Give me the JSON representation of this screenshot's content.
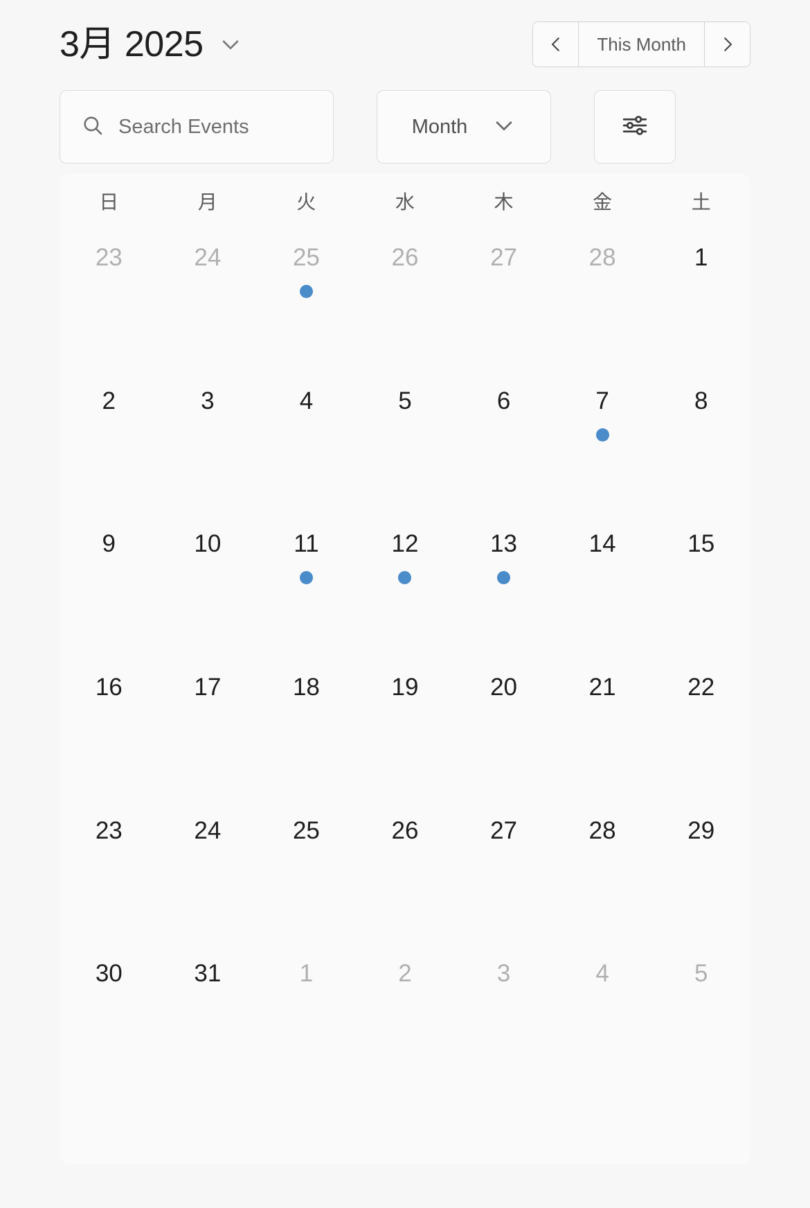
{
  "header": {
    "month_label": "3月 2025",
    "month_dropdown_icon": "chevron-down-icon",
    "nav": {
      "prev_icon": "chevron-left-icon",
      "next_icon": "chevron-right-icon",
      "current_label": "This Month"
    }
  },
  "controls": {
    "search": {
      "icon": "search-icon",
      "placeholder": "Search Events",
      "value": ""
    },
    "view_select": {
      "selected": "Month",
      "icon": "chevron-down-icon",
      "options": [
        "Month"
      ]
    },
    "filter_button": {
      "icon": "filter-sliders-icon",
      "label": ""
    }
  },
  "calendar": {
    "weekdays": [
      "日",
      "月",
      "火",
      "水",
      "木",
      "金",
      "土"
    ],
    "dot_color": "#4a8bc9",
    "weeks": [
      [
        {
          "day": "23",
          "muted": true,
          "dot": false
        },
        {
          "day": "24",
          "muted": true,
          "dot": false
        },
        {
          "day": "25",
          "muted": true,
          "dot": true
        },
        {
          "day": "26",
          "muted": true,
          "dot": false
        },
        {
          "day": "27",
          "muted": true,
          "dot": false
        },
        {
          "day": "28",
          "muted": true,
          "dot": false
        },
        {
          "day": "1",
          "muted": false,
          "dot": false
        }
      ],
      [
        {
          "day": "2",
          "muted": false,
          "dot": false
        },
        {
          "day": "3",
          "muted": false,
          "dot": false
        },
        {
          "day": "4",
          "muted": false,
          "dot": false
        },
        {
          "day": "5",
          "muted": false,
          "dot": false
        },
        {
          "day": "6",
          "muted": false,
          "dot": false
        },
        {
          "day": "7",
          "muted": false,
          "dot": true
        },
        {
          "day": "8",
          "muted": false,
          "dot": false
        }
      ],
      [
        {
          "day": "9",
          "muted": false,
          "dot": false
        },
        {
          "day": "10",
          "muted": false,
          "dot": false
        },
        {
          "day": "11",
          "muted": false,
          "dot": true
        },
        {
          "day": "12",
          "muted": false,
          "dot": true
        },
        {
          "day": "13",
          "muted": false,
          "dot": true
        },
        {
          "day": "14",
          "muted": false,
          "dot": false
        },
        {
          "day": "15",
          "muted": false,
          "dot": false
        }
      ],
      [
        {
          "day": "16",
          "muted": false,
          "dot": false
        },
        {
          "day": "17",
          "muted": false,
          "dot": false
        },
        {
          "day": "18",
          "muted": false,
          "dot": false
        },
        {
          "day": "19",
          "muted": false,
          "dot": false
        },
        {
          "day": "20",
          "muted": false,
          "dot": false
        },
        {
          "day": "21",
          "muted": false,
          "dot": false
        },
        {
          "day": "22",
          "muted": false,
          "dot": false
        }
      ],
      [
        {
          "day": "23",
          "muted": false,
          "dot": false
        },
        {
          "day": "24",
          "muted": false,
          "dot": false
        },
        {
          "day": "25",
          "muted": false,
          "dot": false
        },
        {
          "day": "26",
          "muted": false,
          "dot": false
        },
        {
          "day": "27",
          "muted": false,
          "dot": false
        },
        {
          "day": "28",
          "muted": false,
          "dot": false
        },
        {
          "day": "29",
          "muted": false,
          "dot": false
        }
      ],
      [
        {
          "day": "30",
          "muted": false,
          "dot": false
        },
        {
          "day": "31",
          "muted": false,
          "dot": false
        },
        {
          "day": "1",
          "muted": true,
          "dot": false
        },
        {
          "day": "2",
          "muted": true,
          "dot": false
        },
        {
          "day": "3",
          "muted": true,
          "dot": false
        },
        {
          "day": "4",
          "muted": true,
          "dot": false
        },
        {
          "day": "5",
          "muted": true,
          "dot": false
        }
      ]
    ]
  }
}
